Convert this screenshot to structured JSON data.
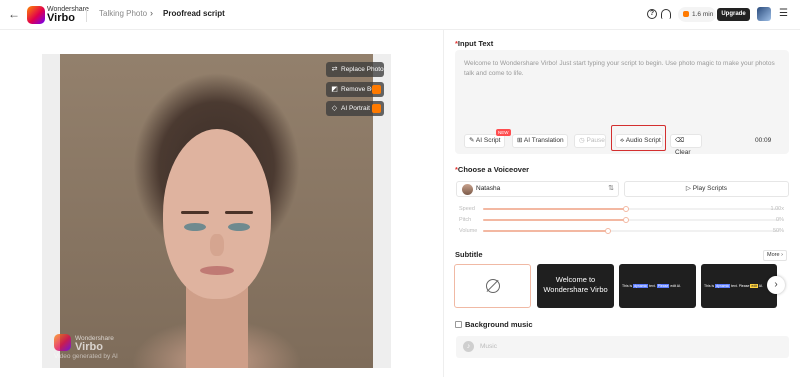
{
  "header": {
    "logo_small": "Wondershare",
    "logo_big": "Virbo",
    "breadcrumb_parent": "Talking Photo",
    "breadcrumb_separator": "›",
    "breadcrumb_current": "Proofread script",
    "help_icon": "help-circle-icon",
    "support_icon": "headset-icon",
    "minutes": "1.6 min",
    "upgrade_label": "Upgrade"
  },
  "photo": {
    "replace_label": "Replace Photo",
    "remove_bg_label": "Remove BG",
    "ai_portrait_label": "AI Portrait",
    "watermark_small": "Wondershare",
    "watermark_big": "Virbo",
    "watermark_generated": "Video generated by AI"
  },
  "input_text": {
    "title": "Input Text",
    "content": "Welcome to Wondershare Virbo! Just start typing your script to begin. Use photo magic to make your photos talk and come to life.",
    "new_badge": "NEW",
    "buttons": [
      "AI Script",
      "AI Translation",
      "Pause",
      "Audio Script",
      "Clear"
    ],
    "timer": "00:09"
  },
  "voiceover": {
    "title": "Choose a Voiceover",
    "voice_name": "Natasha",
    "play_label": "Play Scripts",
    "sliders": [
      {
        "label": "Speed",
        "value_text": "1.00x",
        "level": 0.48
      },
      {
        "label": "Pitch",
        "value_text": "0%",
        "level": 0.48
      },
      {
        "label": "Volume",
        "value_text": "50%",
        "level": 0.42
      }
    ]
  },
  "subtitle": {
    "title": "Subtitle",
    "more_label": "More ›",
    "welcome_card": "Welcome to Wondershare Virbo",
    "mini_card_1": {
      "pre": "This is ",
      "hl1": "dynamic",
      "mid": " text. ",
      "hl2": "Please",
      "post": " edit AI."
    },
    "mini_card_2": {
      "pre": "This is ",
      "hl1": "dynamic",
      "mid": " text. Please ",
      "hl2": "edit",
      "post": " AI."
    },
    "next_arrow": "›"
  },
  "background_music": {
    "label": "Background music",
    "placeholder": "Music"
  },
  "colors": {
    "accent": "#f3b8a2",
    "highlight_border": "#d32f2f",
    "brand_orange": "#ff7a00"
  }
}
